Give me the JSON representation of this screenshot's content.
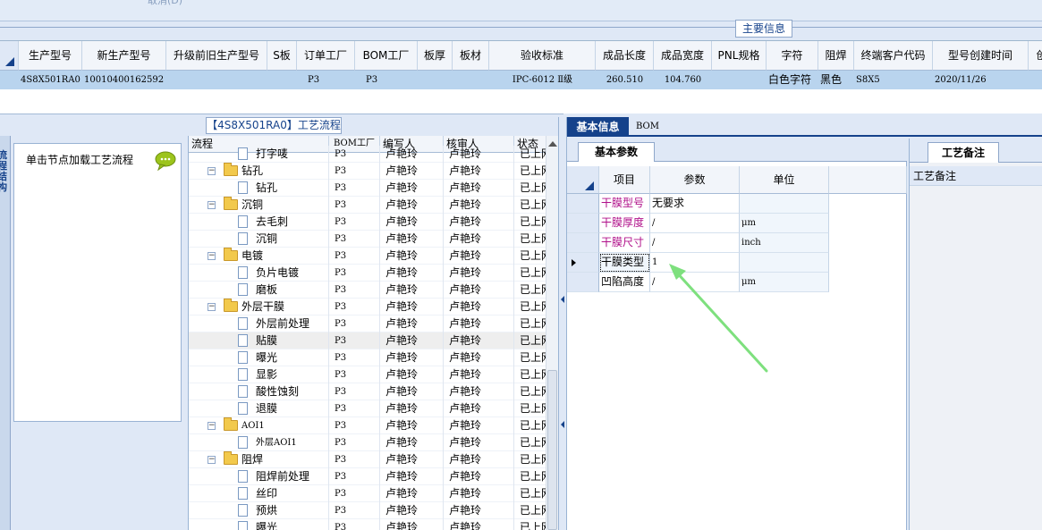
{
  "top_section": {
    "title": "主要信息",
    "faint_label": "取消(D)"
  },
  "main_grid": {
    "columns": [
      "生产型号",
      "新生产型号",
      "升级前旧生产型号",
      "S板",
      "订单工厂",
      "BOM工厂",
      "板厚",
      "板材",
      "验收标准",
      "成品长度",
      "成品宽度",
      "PNL规格",
      "字符",
      "阻焊",
      "终端客户代码",
      "型号创建时间",
      "创"
    ],
    "row": [
      "4S8X501RA0",
      "10010400162592",
      "",
      "",
      "P3",
      "P3",
      "",
      "",
      "IPC-6012 Ⅱ级",
      "260.510",
      "104.760",
      "",
      "白色字符",
      "黑色",
      "S8X5",
      "2020/11/26",
      ""
    ]
  },
  "process_panel": {
    "title": "【4S8X501RA0】工艺流程",
    "side_label": "流程结构",
    "hint": "单击节点加载工艺流程",
    "tree_columns": [
      "流程",
      "BOM工厂",
      "编写人",
      "核审人",
      "状态"
    ],
    "rows": [
      {
        "name": "打字唛",
        "level": 2,
        "bom": "P3",
        "writer": "卢艳玲",
        "reviewer": "卢艳玲",
        "status": "已上网"
      },
      {
        "name": "钻孔",
        "level": 1,
        "bom": "P3",
        "writer": "卢艳玲",
        "reviewer": "卢艳玲",
        "status": "已上网"
      },
      {
        "name": "钻孔",
        "level": 2,
        "bom": "P3",
        "writer": "卢艳玲",
        "reviewer": "卢艳玲",
        "status": "已上网"
      },
      {
        "name": "沉铜",
        "level": 1,
        "bom": "P3",
        "writer": "卢艳玲",
        "reviewer": "卢艳玲",
        "status": "已上网"
      },
      {
        "name": "去毛刺",
        "level": 2,
        "bom": "P3",
        "writer": "卢艳玲",
        "reviewer": "卢艳玲",
        "status": "已上网"
      },
      {
        "name": "沉铜",
        "level": 2,
        "bom": "P3",
        "writer": "卢艳玲",
        "reviewer": "卢艳玲",
        "status": "已上网"
      },
      {
        "name": "电镀",
        "level": 1,
        "bom": "P3",
        "writer": "卢艳玲",
        "reviewer": "卢艳玲",
        "status": "已上网"
      },
      {
        "name": "负片电镀",
        "level": 2,
        "bom": "P3",
        "writer": "卢艳玲",
        "reviewer": "卢艳玲",
        "status": "已上网"
      },
      {
        "name": "磨板",
        "level": 2,
        "bom": "P3",
        "writer": "卢艳玲",
        "reviewer": "卢艳玲",
        "status": "已上网"
      },
      {
        "name": "外层干膜",
        "level": 1,
        "bom": "P3",
        "writer": "卢艳玲",
        "reviewer": "卢艳玲",
        "status": "已上网"
      },
      {
        "name": "外层前处理",
        "level": 2,
        "bom": "P3",
        "writer": "卢艳玲",
        "reviewer": "卢艳玲",
        "status": "已上网"
      },
      {
        "name": "贴膜",
        "level": 2,
        "bom": "P3",
        "writer": "卢艳玲",
        "reviewer": "卢艳玲",
        "status": "已上网",
        "selected": true
      },
      {
        "name": "曝光",
        "level": 2,
        "bom": "P3",
        "writer": "卢艳玲",
        "reviewer": "卢艳玲",
        "status": "已上网"
      },
      {
        "name": "显影",
        "level": 2,
        "bom": "P3",
        "writer": "卢艳玲",
        "reviewer": "卢艳玲",
        "status": "已上网"
      },
      {
        "name": "酸性蚀刻",
        "level": 2,
        "bom": "P3",
        "writer": "卢艳玲",
        "reviewer": "卢艳玲",
        "status": "已上网"
      },
      {
        "name": "退膜",
        "level": 2,
        "bom": "P3",
        "writer": "卢艳玲",
        "reviewer": "卢艳玲",
        "status": "已上网"
      },
      {
        "name": "AOI1",
        "level": 1,
        "bom": "P3",
        "writer": "卢艳玲",
        "reviewer": "卢艳玲",
        "status": "已上网"
      },
      {
        "name": "外层AOI1",
        "level": 2,
        "bom": "P3",
        "writer": "卢艳玲",
        "reviewer": "卢艳玲",
        "status": "已上网"
      },
      {
        "name": "阻焊",
        "level": 1,
        "bom": "P3",
        "writer": "卢艳玲",
        "reviewer": "卢艳玲",
        "status": "已上网"
      },
      {
        "name": "阻焊前处理",
        "level": 2,
        "bom": "P3",
        "writer": "卢艳玲",
        "reviewer": "卢艳玲",
        "status": "已上网"
      },
      {
        "name": "丝印",
        "level": 2,
        "bom": "P3",
        "writer": "卢艳玲",
        "reviewer": "卢艳玲",
        "status": "已上网"
      },
      {
        "name": "预烘",
        "level": 2,
        "bom": "P3",
        "writer": "卢艳玲",
        "reviewer": "卢艳玲",
        "status": "已上网"
      },
      {
        "name": "曝光",
        "level": 2,
        "bom": "P3",
        "writer": "卢艳玲",
        "reviewer": "卢艳玲",
        "status": "已上网"
      }
    ]
  },
  "right_tabs": {
    "basic": "基本信息",
    "bom": "BOM"
  },
  "params": {
    "tab": "基本参数",
    "columns": [
      "项目",
      "参数",
      "单位"
    ],
    "rows": [
      {
        "item": "干膜型号",
        "value": "无要求",
        "unit": ""
      },
      {
        "item": "干膜厚度",
        "value": "/",
        "unit": "μm"
      },
      {
        "item": "干膜尺寸",
        "value": "/",
        "unit": "inch"
      },
      {
        "item": "干膜类型",
        "value": "1",
        "unit": "",
        "current": true
      },
      {
        "item": "凹陷高度",
        "value": "/",
        "unit": "μm"
      }
    ]
  },
  "memo": {
    "tab": "工艺备注",
    "title": "工艺备注"
  },
  "colors": {
    "accent": "#15428b",
    "selection": "#b9d4ee",
    "label": "#b0108a",
    "annotation_arrow": "#7ee07e"
  }
}
